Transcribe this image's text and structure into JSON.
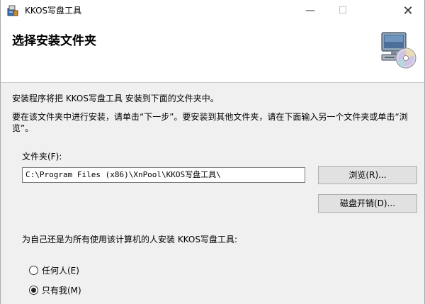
{
  "window": {
    "title": "KKOS写盘工具",
    "minimize_glyph": "—",
    "maximize_glyph": "☐",
    "close_glyph": "✕"
  },
  "header": {
    "title": "选择安装文件夹",
    "art_icon": "computer-cd-icon"
  },
  "body": {
    "intro": "安装程序将把 KKOS写盘工具 安装到下面的文件夹中。",
    "instructions": "要在该文件夹中进行安装，请单击“下一步”。要安装到其他文件夹，请在下面输入另一个文件夹或单击“浏览”。"
  },
  "folder": {
    "label": "文件夹(F):",
    "path": "C:\\Program Files (x86)\\XnPool\\KKOS写盘工具\\"
  },
  "buttons": {
    "browse": "浏览(R)...",
    "disk_cost": "磁盘开销(D)..."
  },
  "install_for": {
    "question": "为自己还是为所有使用该计算机的人安装 KKOS写盘工具:",
    "options": [
      {
        "label": "任何人(E)",
        "selected": false
      },
      {
        "label": "只有我(M)",
        "selected": true
      }
    ]
  }
}
